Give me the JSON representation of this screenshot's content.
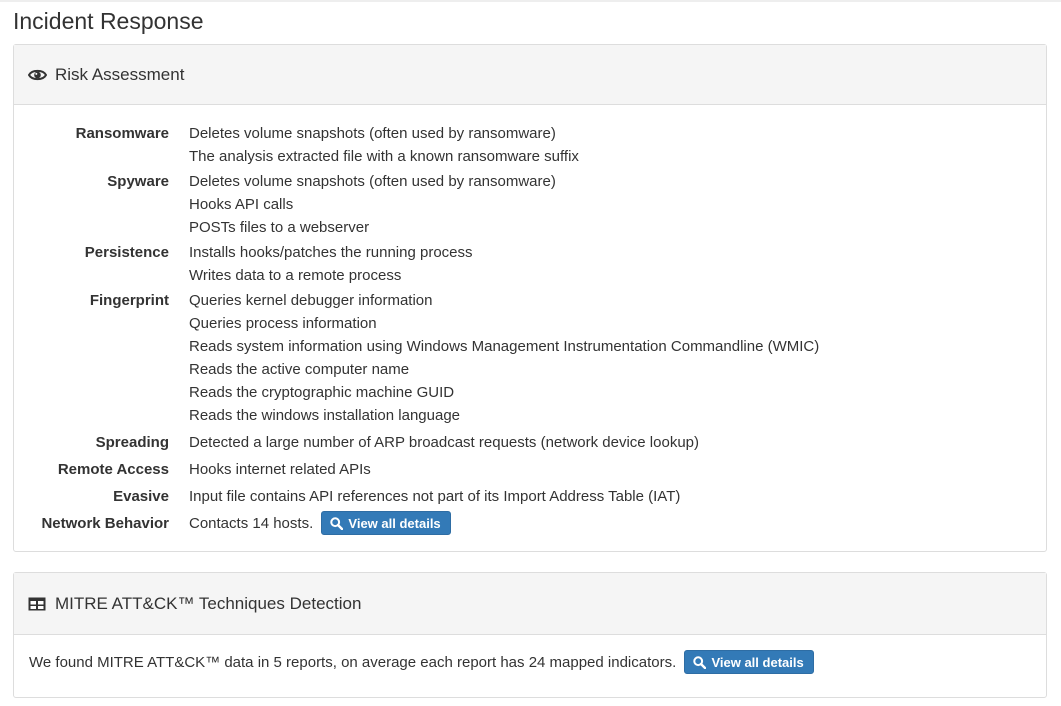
{
  "page": {
    "title": "Incident Response"
  },
  "risk_panel": {
    "title": "Risk Assessment",
    "icon": "eye-icon",
    "categories": [
      {
        "name": "Ransomware",
        "items": [
          "Deletes volume snapshots (often used by ransomware)",
          "The analysis extracted file with a known ransomware suffix"
        ]
      },
      {
        "name": "Spyware",
        "items": [
          "Deletes volume snapshots (often used by ransomware)",
          "Hooks API calls",
          "POSTs files to a webserver"
        ]
      },
      {
        "name": "Persistence",
        "items": [
          "Installs hooks/patches the running process",
          "Writes data to a remote process"
        ]
      },
      {
        "name": "Fingerprint",
        "items": [
          "Queries kernel debugger information",
          "Queries process information",
          "Reads system information using Windows Management Instrumentation Commandline (WMIC)",
          "Reads the active computer name",
          "Reads the cryptographic machine GUID",
          "Reads the windows installation language"
        ]
      },
      {
        "name": "Spreading",
        "items": [
          "Detected a large number of ARP broadcast requests (network device lookup)"
        ]
      },
      {
        "name": "Remote Access",
        "items": [
          "Hooks internet related APIs"
        ]
      },
      {
        "name": "Evasive",
        "items": [
          "Input file contains API references not part of its Import Address Table (IAT)"
        ]
      },
      {
        "name": "Network Behavior",
        "items": [
          "Contacts 14 hosts."
        ]
      }
    ],
    "network_button_label": "View all details"
  },
  "mitre_panel": {
    "title": "MITRE ATT&CK™ Techniques Detection",
    "icon": "table-icon",
    "text": "We found MITRE ATT&CK™ data in 5 reports, on average each report has 24 mapped indicators.",
    "button_label": "View all details"
  },
  "colors": {
    "button_bg": "#337ab7",
    "heading_bg": "#f5f5f5",
    "border": "#dddddd"
  }
}
